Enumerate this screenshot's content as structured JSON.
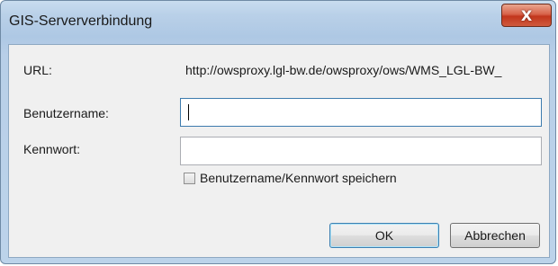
{
  "window": {
    "title": "GIS-Serververbindung",
    "close_symbol": "X"
  },
  "form": {
    "url_label": "URL:",
    "url_value": "http://owsproxy.lgl-bw.de/owsproxy/ows/WMS_LGL-BW_",
    "username_label": "Benutzername:",
    "username_value": "",
    "password_label": "Kennwort:",
    "password_value": "",
    "save_checkbox_label": "Benutzername/Kennwort speichern",
    "save_checked": false
  },
  "buttons": {
    "ok_label": "OK",
    "cancel_label": "Abbrechen"
  },
  "icons": {
    "close": "close-icon"
  }
}
